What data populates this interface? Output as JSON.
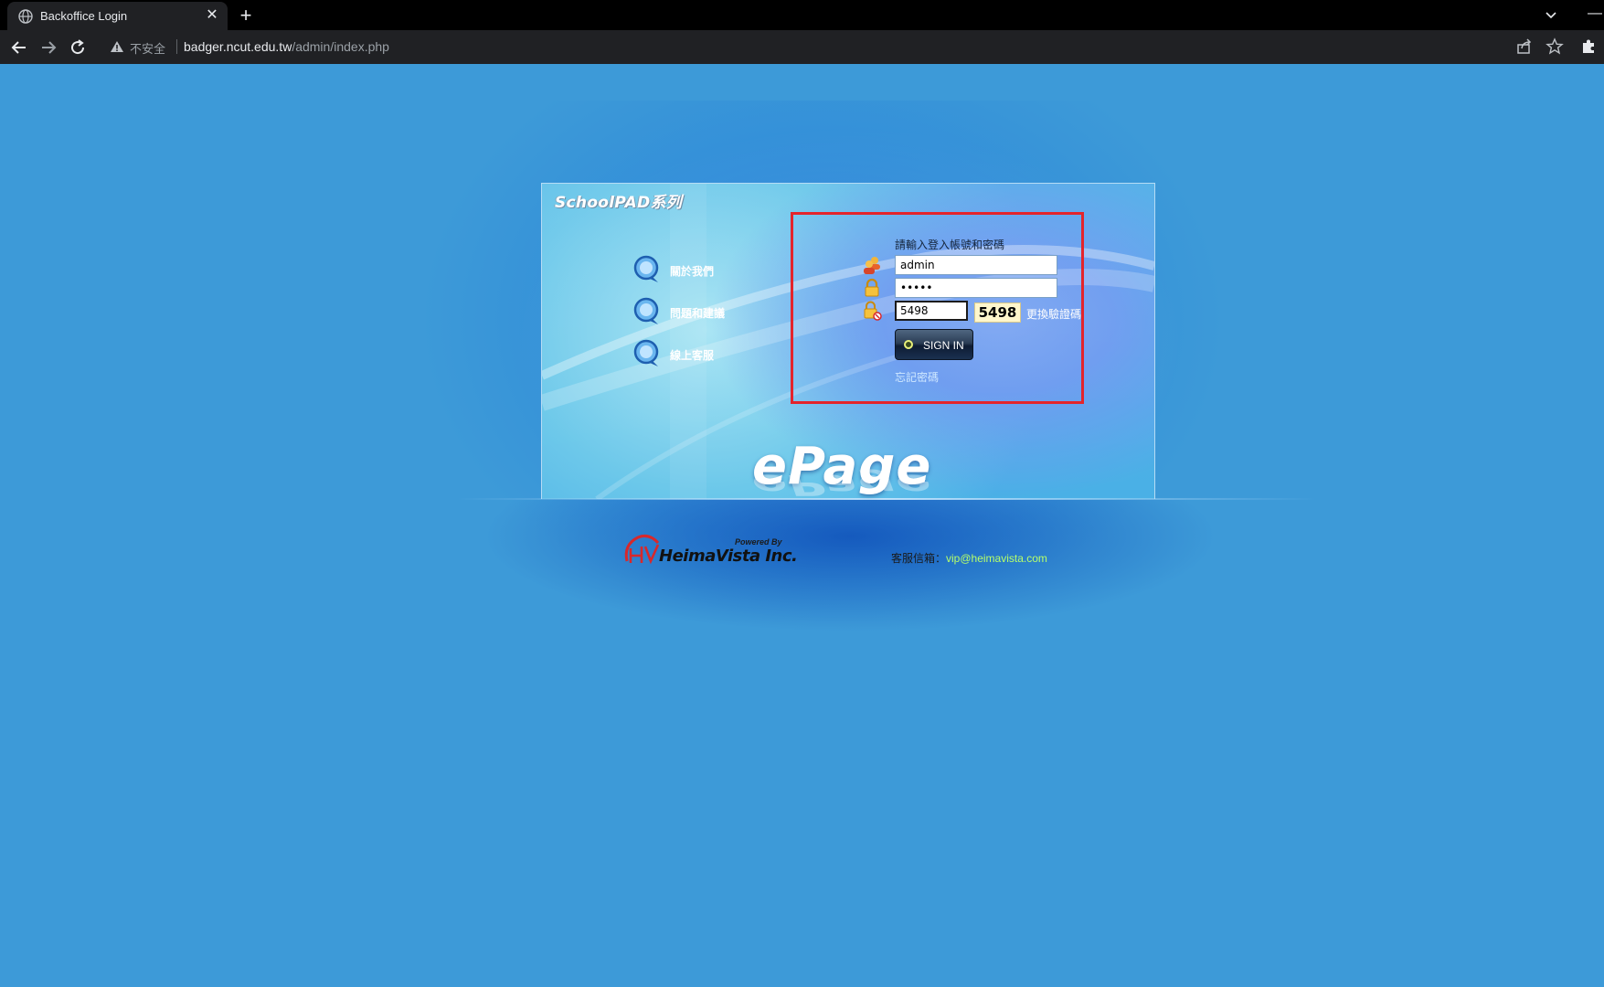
{
  "browser": {
    "tab_title": "Backoffice Login",
    "close_glyph": "✕",
    "newtab_glyph": "+",
    "minimize_glyph": "—",
    "insecure_label": "不安全",
    "url_host": "badger.ncut.edu.tw",
    "url_path": "/admin/index.php",
    "icons": [
      "globe-icon",
      "back-arrow-icon",
      "forward-arrow-icon",
      "reload-icon",
      "warning-icon",
      "share-icon",
      "star-icon",
      "puzzle-icon"
    ]
  },
  "login": {
    "brand": "SchoolPAD系列",
    "nav": [
      {
        "label": "關於我們"
      },
      {
        "label": "問題和建議"
      },
      {
        "label": "線上客服"
      }
    ],
    "prompt": "請輸入登入帳號和密碼",
    "username": "admin",
    "password_masked": "•••••",
    "captcha_input": "5498",
    "captcha_code": "5498",
    "refresh_label": "更換驗證碼",
    "signin_label": "SIGN IN",
    "forgot_label": "忘記密碼",
    "product": "ePage"
  },
  "footer": {
    "powered_by": "Powered By",
    "company": "HeimaVista Inc.",
    "contact_label": "客服信箱：",
    "contact_email": "vip@heimavista.com"
  },
  "colors": {
    "page_bg": "#3d9ad8",
    "highlight_box": "#e4242b",
    "email_link": "#b6ff6a"
  }
}
